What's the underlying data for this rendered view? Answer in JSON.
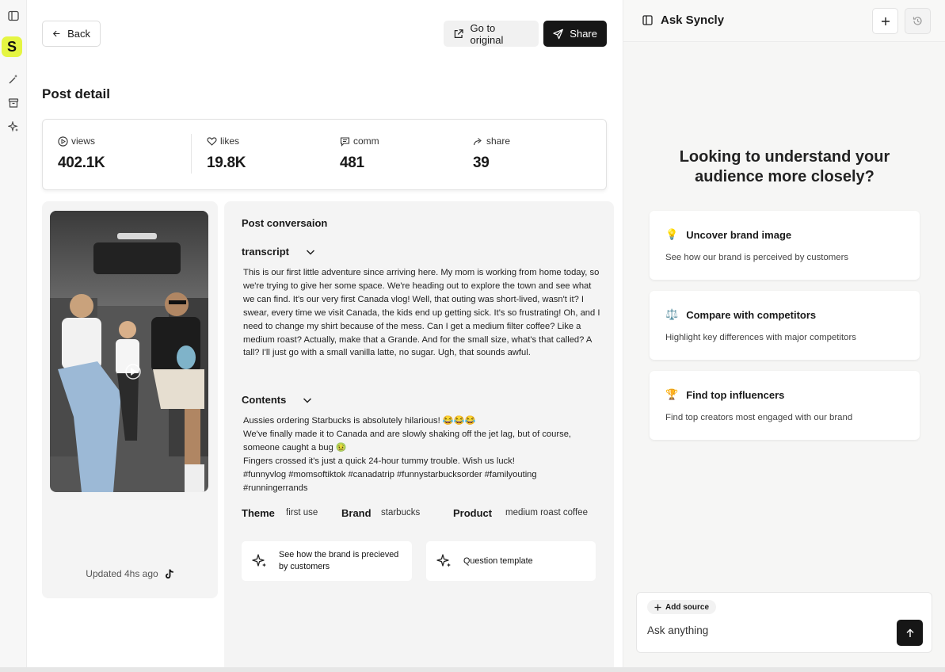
{
  "header": {
    "back_label": "Back",
    "go_original_label": "Go to original",
    "share_label": "Share"
  },
  "page_title": "Post detail",
  "stats": [
    {
      "label": "views",
      "value": "402.1K",
      "icon": "play-circle-icon"
    },
    {
      "label": "likes",
      "value": "19.8K",
      "icon": "heart-icon"
    },
    {
      "label": "comm",
      "value": "481",
      "icon": "comment-icon"
    },
    {
      "label": "share",
      "value": "39",
      "icon": "share-arrow-icon"
    }
  ],
  "media": {
    "updated": "Updated 4hs ago",
    "platform_icon": "tiktok-icon"
  },
  "conversation": {
    "title": "Post conversaion",
    "transcript": {
      "heading": "transcript",
      "text": "This is our first little adventure since arriving here. My mom is working from home today, so we're trying to give her some space. We're heading out to explore the town and see what we can find. It's our very first Canada vlog! Well, that outing was short-lived, wasn't it? I swear, every time we visit Canada, the kids end up getting sick. It's so frustrating! Oh, and I need to change my shirt because of the mess. Can I get a medium filter coffee? Like a medium roast? Actually, make that a Grande. And for the small size, what's that called? A tall? I'll just go with a small vanilla latte, no sugar. Ugh, that sounds awful."
    },
    "contents": {
      "heading": "Contents",
      "lines": [
        "Aussies ordering Starbucks is absolutely hilarious! 😂😂😂",
        "We've finally made it to Canada and are slowly shaking off the jet lag, but of course, someone caught a bug 🤢",
        "Fingers crossed it's just a quick 24-hour tummy trouble. Wish us luck!",
        "#funnyvlog #momsoftiktok #canadatrip #funnystarbucksorder #familyouting #runningerrands"
      ]
    },
    "meta": {
      "theme_label": "Theme",
      "theme_value": "first use",
      "brand_label": "Brand",
      "brand_value": "starbucks",
      "product_label": "Product",
      "product_value": "medium roast coffee"
    },
    "quick_actions": [
      {
        "label": "See how the brand is precieved by customers",
        "icon": "sparkle-icon"
      },
      {
        "label": "Question template",
        "icon": "sparkle-icon"
      }
    ]
  },
  "assistant": {
    "title": "Ask Syncly",
    "hero": "Looking to understand your audience more closely?",
    "suggestions": [
      {
        "emoji": "💡",
        "title": "Uncover brand image",
        "desc": "See how our brand is perceived by customers"
      },
      {
        "emoji": "⚖️",
        "title": "Compare with competitors",
        "desc": "Highlight key differences with major competitors"
      },
      {
        "emoji": "🏆",
        "title": "Find top influencers",
        "desc": "Find top creators most engaged with our brand"
      }
    ],
    "add_source_label": "Add source",
    "input_placeholder": "Ask anything"
  },
  "brand_letter": "S"
}
